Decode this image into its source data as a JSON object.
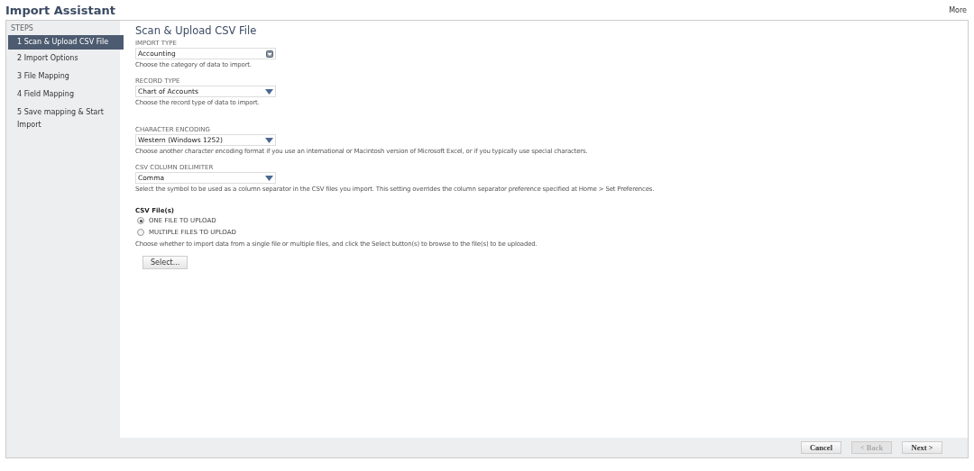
{
  "header": {
    "title": "Import Assistant",
    "more": "More"
  },
  "sidebar": {
    "heading": "STEPS",
    "items": [
      {
        "label": "1 Scan & Upload CSV File",
        "selected": true
      },
      {
        "label": "2 Import Options",
        "selected": false
      },
      {
        "label": "3 File Mapping",
        "selected": false
      },
      {
        "label": "4 Field Mapping",
        "selected": false
      },
      {
        "label": "5 Save mapping & Start Import",
        "selected": false
      }
    ]
  },
  "content": {
    "title": "Scan & Upload CSV File",
    "fields": [
      {
        "label": "IMPORT TYPE",
        "value": "Accounting",
        "kind": "picker",
        "hint": "Choose the category of data to import."
      },
      {
        "label": "RECORD TYPE",
        "value": "Chart of Accounts",
        "kind": "select",
        "hint": "Choose the record type of data to import."
      },
      {
        "label": "CHARACTER ENCODING",
        "value": "Western (Windows 1252)",
        "kind": "select",
        "hint": "Choose another character encoding format if you use an international or Macintosh version of Microsoft Excel, or if you typically use special characters."
      },
      {
        "label": "CSV COLUMN DELIMITER",
        "value": "Comma",
        "kind": "select",
        "hint": "Select the symbol to be used as a column separator in the CSV files you import. This setting overrides the column separator preference specified at Home > Set Preferences."
      }
    ],
    "files": {
      "label": "CSV File(s)",
      "options": [
        {
          "label": "ONE FILE TO UPLOAD",
          "selected": true
        },
        {
          "label": "MULTIPLE FILES TO UPLOAD",
          "selected": false
        }
      ],
      "hint": "Choose whether to import data from a single file or multiple files, and click the Select button(s) to browse to the file(s) to be uploaded.",
      "button": "Select..."
    }
  },
  "footer": {
    "buttons": [
      {
        "label": "Cancel",
        "disabled": false
      },
      {
        "label": "< Back",
        "disabled": true
      },
      {
        "label": "Next >",
        "disabled": false
      }
    ]
  }
}
